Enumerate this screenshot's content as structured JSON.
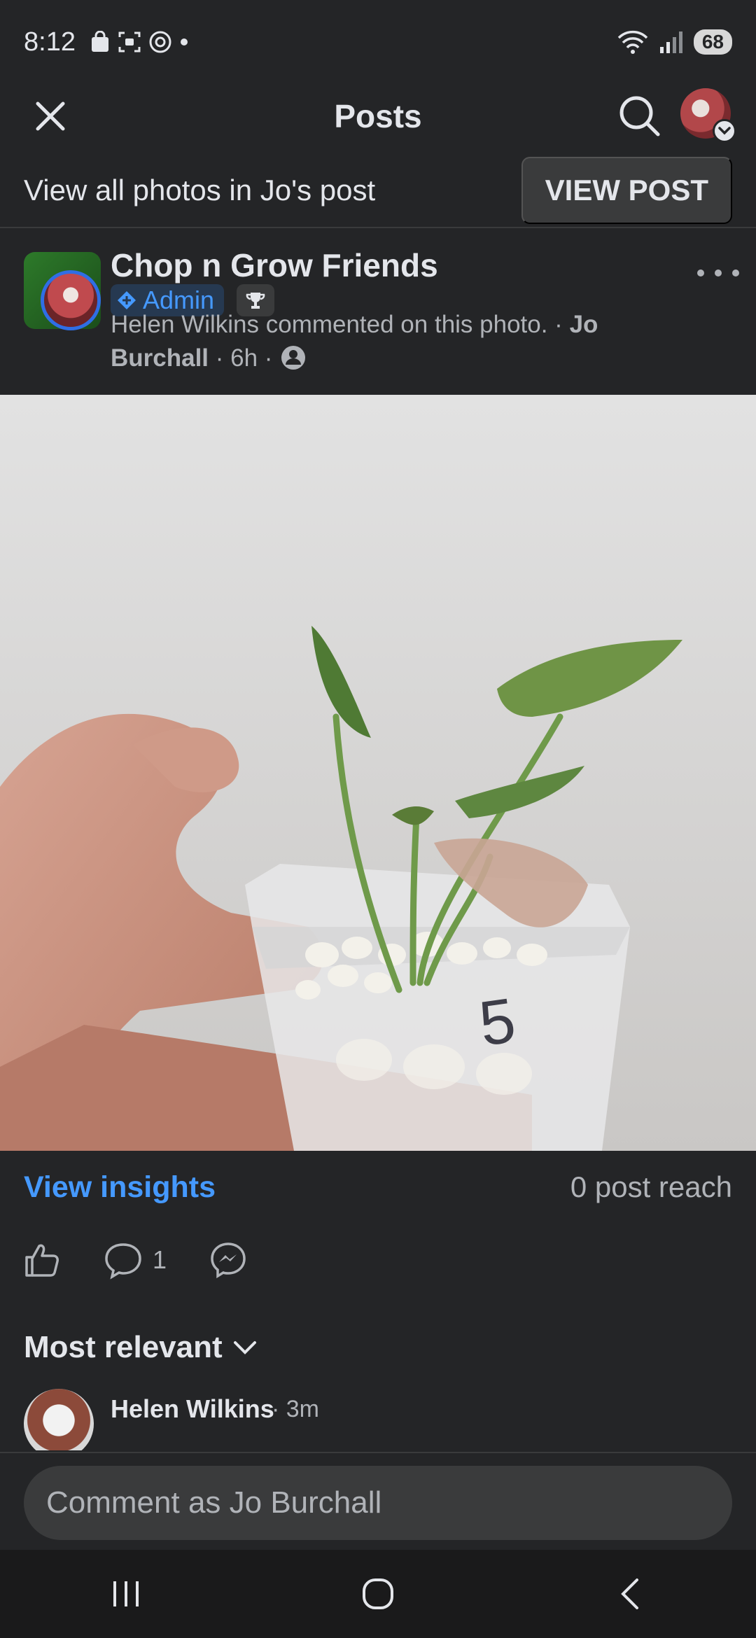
{
  "status_bar": {
    "time": "8:12",
    "battery": "68"
  },
  "header": {
    "title": "Posts"
  },
  "photo_banner": {
    "text": "View all photos in Jo's post",
    "button_label": "VIEW POST"
  },
  "post": {
    "group_name": "Chop n Grow Friends",
    "badge_label": "Admin",
    "meta_activity": "Helen Wilkins commented on this photo. · ",
    "author": "Jo Burchall",
    "time": " · 6h · "
  },
  "photo": {
    "pot_label": "5"
  },
  "insights": {
    "link_label": "View insights",
    "reach": "0 post reach"
  },
  "actions": {
    "comment_count": "1"
  },
  "comments": {
    "sort_label": "Most relevant",
    "items": [
      {
        "name": "Helen Wilkins",
        "time": "· 3m"
      }
    ]
  },
  "comment_box": {
    "placeholder": "Comment as Jo Burchall"
  },
  "colors": {
    "background": "#242527",
    "accent": "#4599ff",
    "admin_badge_bg": "#263951"
  }
}
